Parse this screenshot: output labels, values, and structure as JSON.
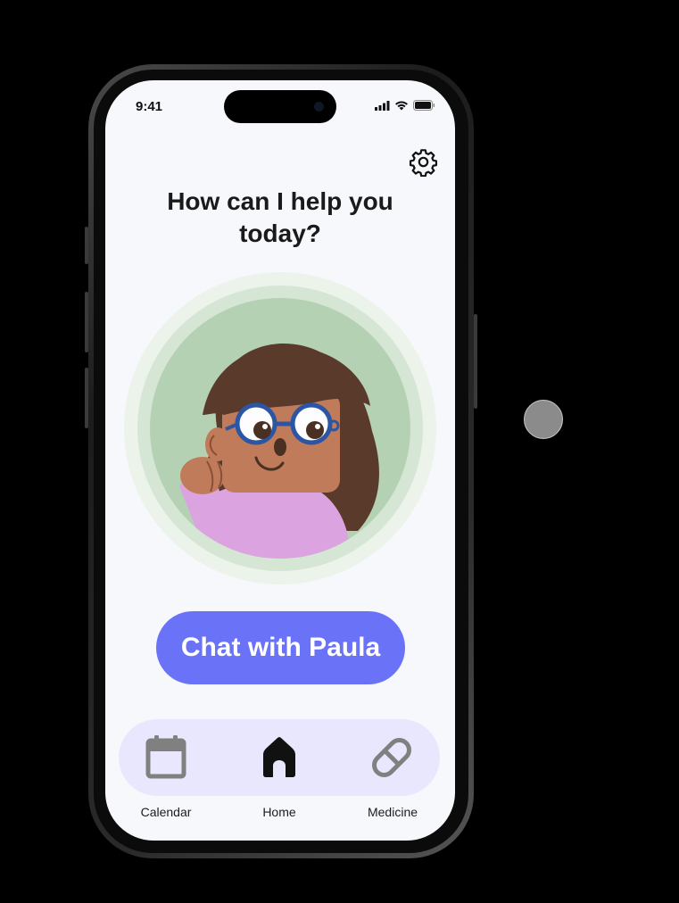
{
  "status_bar": {
    "time": "9:41"
  },
  "header": {
    "title": "How can I help you today?"
  },
  "main": {
    "chat_button_label": "Chat with Paula"
  },
  "nav": {
    "items": [
      {
        "label": "Calendar",
        "icon": "calendar-icon",
        "active": false
      },
      {
        "label": "Home",
        "icon": "home-icon",
        "active": true
      },
      {
        "label": "Medicine",
        "icon": "pill-icon",
        "active": false
      }
    ]
  },
  "colors": {
    "accent": "#6a73f8",
    "nav_background": "#e9e7fd",
    "avatar_background": "#b5d1b3",
    "screen_background": "#f7f8fb"
  }
}
